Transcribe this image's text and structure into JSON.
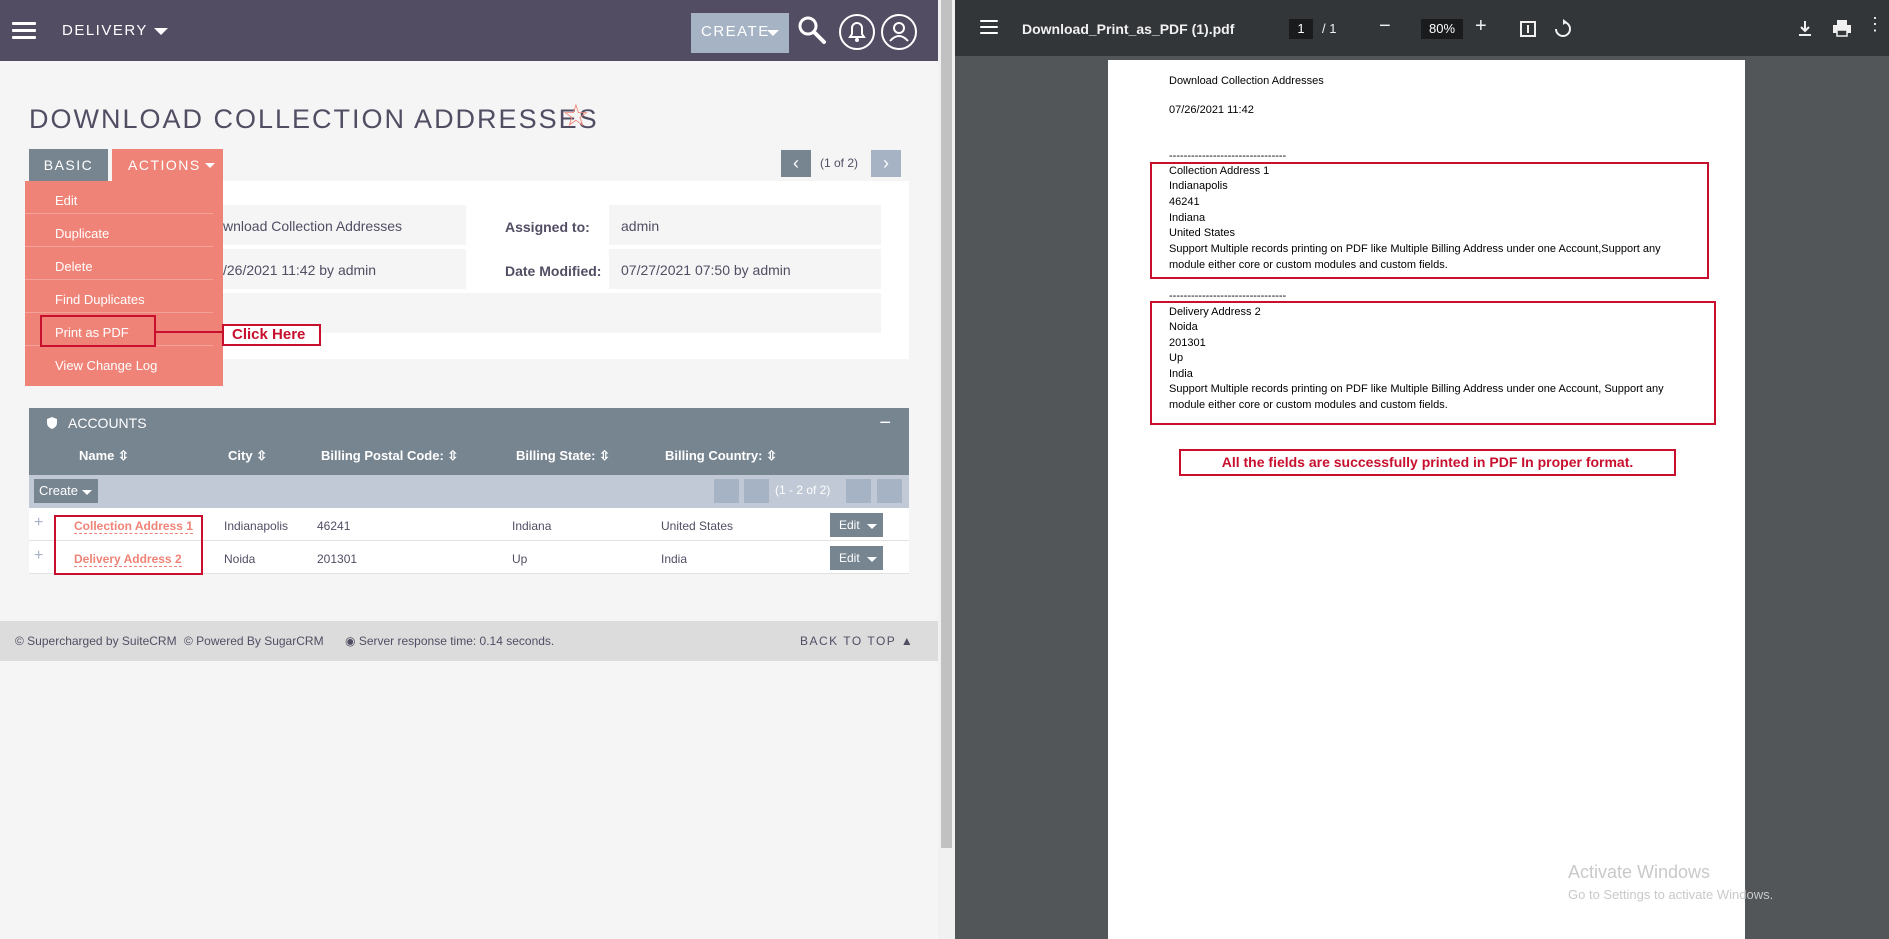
{
  "crm": {
    "module": "DELIVERY",
    "create_label": "CREATE",
    "title": "DOWNLOAD COLLECTION ADDRESSES",
    "star": "☆",
    "tabs": {
      "basic": "BASIC",
      "actions": "ACTIONS"
    },
    "pager": {
      "prev": "‹",
      "text": "(1 of 2)",
      "next": "›"
    },
    "actions_menu": [
      "Edit",
      "Duplicate",
      "Delete",
      "Find Duplicates",
      "Print as PDF",
      "View Change Log"
    ],
    "annotation": "Click Here",
    "detail": {
      "name_value": "wnload Collection Addresses",
      "assigned_label": "Assigned to:",
      "assigned_value": "admin",
      "created_value": "/26/2021 11:42 by admin",
      "modified_label": "Date Modified:",
      "modified_value": "07/27/2021 07:50 by admin"
    },
    "subpanel": {
      "title": "ACCOUNTS",
      "collapse": "−",
      "columns": [
        "Name",
        "City",
        "Billing Postal Code:",
        "Billing State:",
        "Billing Country:"
      ],
      "create": "Create",
      "pager_text": "(1 - 2 of 2)",
      "rows": [
        {
          "name": "Collection Address 1",
          "city": "Indianapolis",
          "postal": "46241",
          "state": "Indiana",
          "country": "United States",
          "edit": "Edit"
        },
        {
          "name": "Delivery Address 2",
          "city": "Noida",
          "postal": "201301",
          "state": "Up",
          "country": "India",
          "edit": "Edit"
        }
      ]
    },
    "footer": {
      "suitecrm": "© Supercharged by SuiteCRM",
      "sugarcrm": "© Powered By SugarCRM",
      "response": "Server response time: 0.14 seconds.",
      "back_to_top": "BACK TO TOP ▲"
    }
  },
  "pdf": {
    "filename": "Download_Print_as_PDF (1).pdf",
    "page": "1",
    "total": "/ 1",
    "zoom": "80%",
    "doc": {
      "title": "Download Collection Addresses",
      "date": "07/26/2021 11:42",
      "separator": "--------------------------------",
      "record1": [
        "Collection Address 1",
        "Indianapolis",
        "46241",
        "Indiana",
        "United States",
        "Support Multiple records printing on PDF like Multiple Billing Address under one Account,Support any",
        "module either core or custom modules and custom fields."
      ],
      "record2": [
        "Delivery Address 2",
        "Noida",
        "201301",
        "Up",
        "India",
        "Support Multiple records printing on PDF like Multiple Billing Address under one Account, Support any",
        "module either core or custom modules and custom fields."
      ],
      "note": "All the fields are successfully printed in PDF In proper format."
    }
  },
  "watermark": {
    "line1": "Activate Windows",
    "line2": "Go to Settings to activate Windows."
  },
  "colors": {
    "crm_header": "#534d64",
    "accent": "#f08377",
    "subpanel": "#778591",
    "annotation": "#c8102e",
    "pdf_toolbar": "#323639"
  }
}
